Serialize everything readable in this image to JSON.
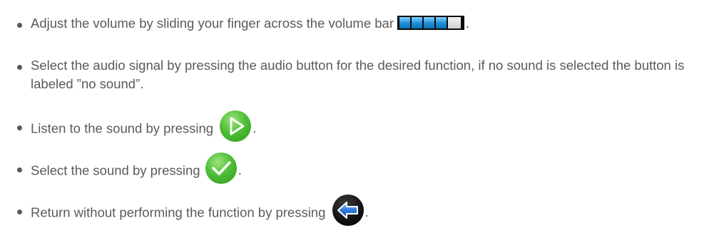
{
  "items": [
    {
      "text_before": "Adjust the volume by sliding your finger across the volume bar",
      "icon": "volume-bar-icon",
      "text_after": "."
    },
    {
      "text": "Select the audio signal by pressing the audio button for the desired function, if no sound is selected the button is labeled ”no sound”."
    },
    {
      "text_before": "Listen to the sound by pressing",
      "icon": "play-icon",
      "text_after": "."
    },
    {
      "text_before": "Select the sound by pressing",
      "icon": "checkmark-icon",
      "text_after": "."
    },
    {
      "text_before": "Return without performing the function by pressing",
      "icon": "back-arrow-icon",
      "text_after": "."
    }
  ],
  "colors": {
    "text": "#5a5a5a",
    "volume_fill": "#1a8fd6",
    "volume_empty": "#d9d9d9",
    "green_button": "#4fbf36",
    "back_button": "#111111",
    "back_arrow": "#2e7be0"
  }
}
